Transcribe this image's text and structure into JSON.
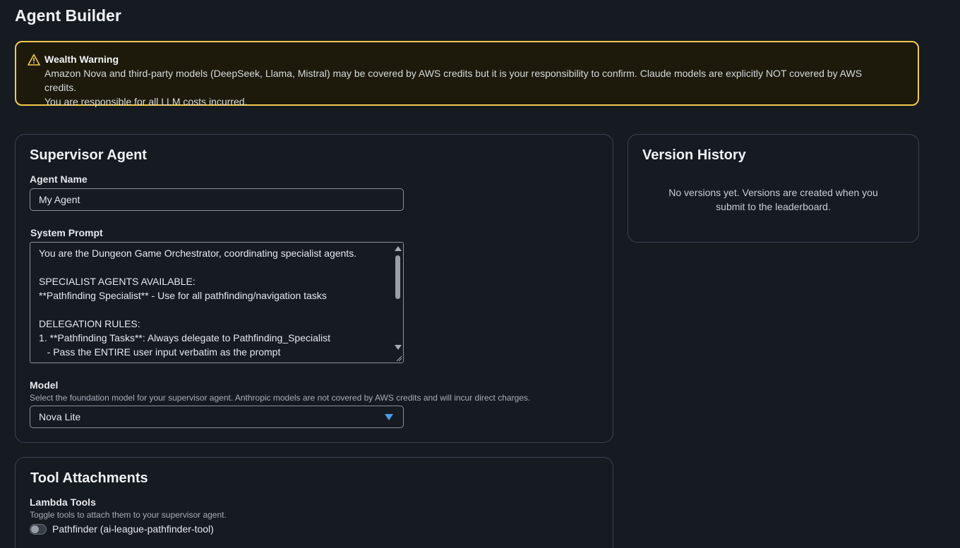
{
  "page": {
    "title": "Agent Builder"
  },
  "warning": {
    "icon": "warning-triangle-icon",
    "title": "Wealth Warning",
    "line1": "Amazon Nova and third-party models (DeepSeek, Llama, Mistral) may be covered by AWS credits but it is your responsibility to confirm. Claude models are explicitly NOT covered by AWS credits.",
    "line2": "You are responsible for all LLM costs incurred.",
    "border_color": "#f2c94c"
  },
  "supervisor": {
    "title": "Supervisor Agent",
    "agent_name_label": "Agent Name",
    "agent_name_value": "My Agent",
    "system_prompt_label": "System Prompt",
    "system_prompt_value": "You are the Dungeon Game Orchestrator, coordinating specialist agents.\n\nSPECIALIST AGENTS AVAILABLE:\n**Pathfinding Specialist** - Use for all pathfinding/navigation tasks\n\nDELEGATION RULES:\n1. **Pathfinding Tasks**: Always delegate to Pathfinding_Specialist\n   - Pass the ENTIRE user input verbatim as the prompt",
    "model_label": "Model",
    "model_hint": "Select the foundation model for your supervisor agent. Anthropic models are not covered by AWS credits and will incur direct charges.",
    "model_value": "Nova Lite",
    "accent_color": "#4a9ee8"
  },
  "version_history": {
    "title": "Version History",
    "empty_line1": "No versions yet. Versions are created when you",
    "empty_line2": "submit to the leaderboard."
  },
  "tools": {
    "title": "Tool Attachments",
    "lambda_label": "Lambda Tools",
    "lambda_hint": "Toggle tools to attach them to your supervisor agent.",
    "items": [
      {
        "label": "Pathfinder (ai-league-pathfinder-tool)",
        "enabled": false
      }
    ]
  }
}
